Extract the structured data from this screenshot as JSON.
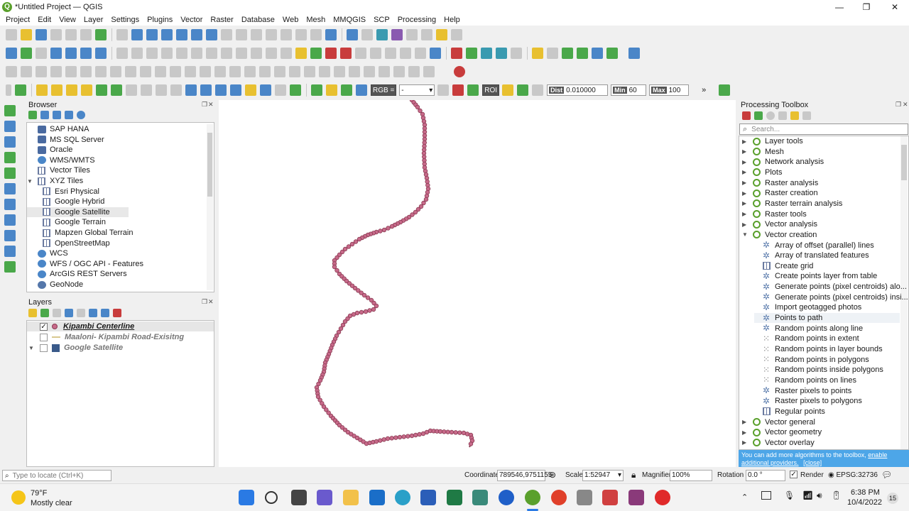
{
  "window": {
    "title": "*Untitled Project — QGIS",
    "logo": "Q"
  },
  "menu": [
    "Project",
    "Edit",
    "View",
    "Layer",
    "Settings",
    "Plugins",
    "Vector",
    "Raster",
    "Database",
    "Web",
    "Mesh",
    "MMQGIS",
    "SCP",
    "Processing",
    "Help"
  ],
  "toolbar_fields": {
    "rgb_label": "RGB =",
    "rgb_value": "-",
    "roi_label": "ROI",
    "dist_label": "Dist",
    "dist_value": "0.010000",
    "min_label": "Min",
    "min_value": "60",
    "max_label": "Max",
    "max_value": "100"
  },
  "browser": {
    "title": "Browser",
    "items": [
      {
        "label": "SAP HANA",
        "icon": "database-icon"
      },
      {
        "label": "MS SQL Server",
        "icon": "database-icon"
      },
      {
        "label": "Oracle",
        "icon": "database-icon"
      },
      {
        "label": "WMS/WMTS",
        "icon": "globe-icon"
      },
      {
        "label": "Vector Tiles",
        "icon": "grid-icon"
      },
      {
        "label": "XYZ Tiles",
        "icon": "grid-icon",
        "expanded": true
      },
      {
        "label": "Esri Physical",
        "icon": "grid-icon",
        "child": true
      },
      {
        "label": "Google Hybrid",
        "icon": "grid-icon",
        "child": true
      },
      {
        "label": "Google Satellite",
        "icon": "grid-icon",
        "child": true,
        "selected": true
      },
      {
        "label": "Google Terrain",
        "icon": "grid-icon",
        "child": true
      },
      {
        "label": "Mapzen Global Terrain",
        "icon": "grid-icon",
        "child": true
      },
      {
        "label": "OpenStreetMap",
        "icon": "grid-icon",
        "child": true
      },
      {
        "label": "WCS",
        "icon": "globe-icon"
      },
      {
        "label": "WFS / OGC API - Features",
        "icon": "globe-icon"
      },
      {
        "label": "ArcGIS REST Servers",
        "icon": "globe-icon"
      },
      {
        "label": "GeoNode",
        "icon": "geonode-icon"
      }
    ]
  },
  "layers": {
    "title": "Layers",
    "items": [
      {
        "label": "Kipambi Centerline",
        "checked": true
      },
      {
        "label": "Maaloni- Kipambi Road-Exisitng",
        "checked": false
      },
      {
        "label": "Google Satellite",
        "checked": false
      }
    ]
  },
  "toolbox": {
    "title": "Processing Toolbox",
    "search_placeholder": "Search...",
    "groups_top": [
      "Layer tools",
      "Mesh",
      "Network analysis",
      "Plots",
      "Raster analysis",
      "Raster creation",
      "Raster terrain analysis",
      "Raster tools",
      "Vector analysis"
    ],
    "expanded_group": "Vector creation",
    "algorithms": [
      {
        "label": "Array of offset (parallel) lines",
        "icon": "gear"
      },
      {
        "label": "Array of translated features",
        "icon": "gear"
      },
      {
        "label": "Create grid",
        "icon": "grid"
      },
      {
        "label": "Create points layer from table",
        "icon": "gear"
      },
      {
        "label": "Generate points (pixel centroids) alo...",
        "icon": "gear"
      },
      {
        "label": "Generate points (pixel centroids) insi...",
        "icon": "gear"
      },
      {
        "label": "Import geotagged photos",
        "icon": "gear"
      },
      {
        "label": "Points to path",
        "icon": "gear",
        "hover": true
      },
      {
        "label": "Random points along line",
        "icon": "gear"
      },
      {
        "label": "Random points in extent",
        "icon": "dots"
      },
      {
        "label": "Random points in layer bounds",
        "icon": "dots"
      },
      {
        "label": "Random points in polygons",
        "icon": "dots"
      },
      {
        "label": "Random points inside polygons",
        "icon": "dots"
      },
      {
        "label": "Random points on lines",
        "icon": "dots"
      },
      {
        "label": "Raster pixels to points",
        "icon": "gear"
      },
      {
        "label": "Raster pixels to polygons",
        "icon": "gear"
      },
      {
        "label": "Regular points",
        "icon": "grid"
      }
    ],
    "groups_bottom": [
      "Vector general",
      "Vector geometry",
      "Vector overlay"
    ],
    "info_text": "You can add more algorithms to the toolbox,",
    "info_link1": "enable additional providers.",
    "info_link2": "[close]"
  },
  "statusbar": {
    "locate_placeholder": "Type to locate (Ctrl+K)",
    "coordinate_label": "Coordinate",
    "coordinate_value": "789546,9751155",
    "scale_label": "Scale",
    "scale_value": "1:52947",
    "magnifier_label": "Magnifier",
    "magnifier_value": "100%",
    "rotation_label": "Rotation",
    "rotation_value": "0.0 °",
    "render_label": "Render",
    "crs": "EPSG:32736"
  },
  "taskbar": {
    "temp": "79°F",
    "weather": "Mostly clear",
    "time": "6:38 PM",
    "date": "10/4/2022",
    "notif": "15"
  },
  "colors": {
    "line": "#8a3a52",
    "point": "#c76a8a",
    "qgis_green": "#5aa02c",
    "info_blue": "#4da6e8"
  }
}
